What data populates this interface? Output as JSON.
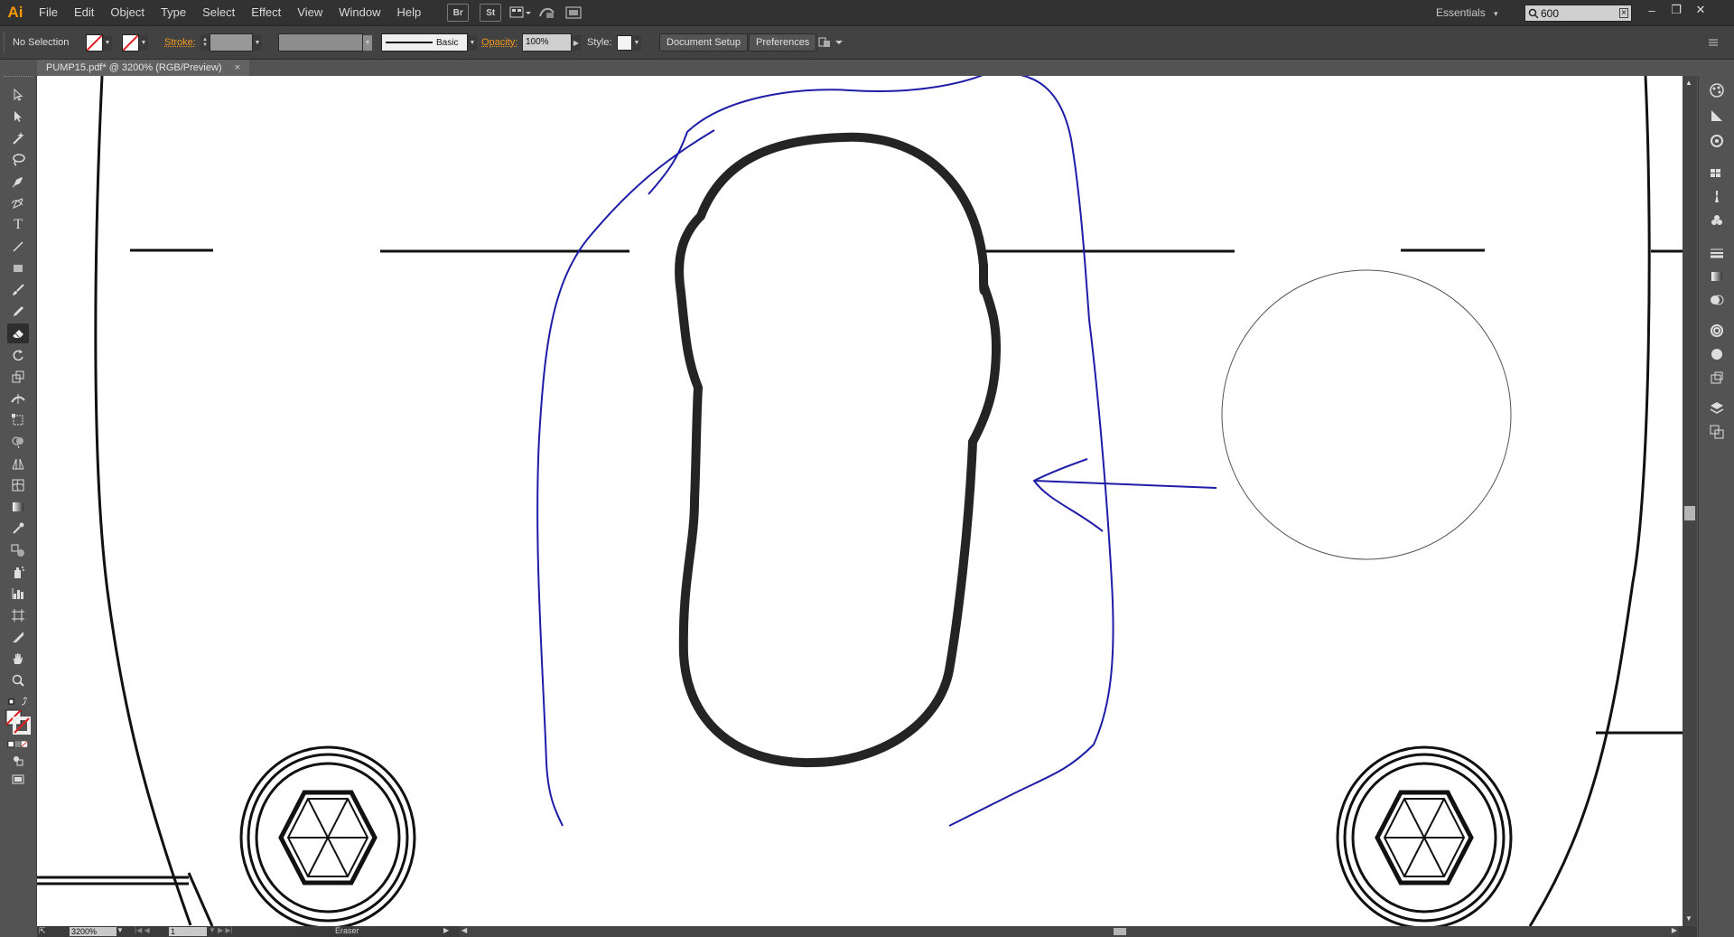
{
  "app": {
    "logo": "Ai",
    "brand_color": "#ff9a00"
  },
  "menu": [
    "File",
    "Edit",
    "Object",
    "Type",
    "Select",
    "Effect",
    "View",
    "Window",
    "Help"
  ],
  "menubar_buttons": {
    "bridge": "Br",
    "stock": "St"
  },
  "workspace": {
    "label": "Essentials",
    "arrow": "▾"
  },
  "search": {
    "value": "600"
  },
  "window_controls": {
    "minimize": "–",
    "restore": "❐",
    "close": "✕"
  },
  "control_bar": {
    "selection_label": "No Selection",
    "stroke_label": "Stroke:",
    "brush_label": "Basic",
    "opacity_label": "Opacity:",
    "opacity_value": "100%",
    "style_label": "Style:",
    "document_setup_label": "Document Setup",
    "preferences_label": "Preferences"
  },
  "document_tab": {
    "title": "PUMP15.pdf* @ 3200% (RGB/Preview)",
    "close": "×"
  },
  "status_bar": {
    "zoom": "3200%",
    "artboard": "1",
    "tool": "Eraser"
  },
  "tools": [
    "selection-tool",
    "direct-selection-tool",
    "magic-wand-tool",
    "lasso-tool",
    "pen-tool",
    "curvature-tool",
    "type-tool",
    "line-segment-tool",
    "rectangle-tool",
    "paintbrush-tool",
    "pencil-tool",
    "eraser-tool",
    "rotate-tool",
    "scale-tool",
    "width-tool",
    "free-transform-tool",
    "shape-builder-tool",
    "perspective-grid-tool",
    "mesh-tool",
    "gradient-tool",
    "eyedropper-tool",
    "blend-tool",
    "symbol-sprayer-tool",
    "column-graph-tool",
    "artboard-tool",
    "slice-tool",
    "hand-tool",
    "zoom-tool"
  ],
  "active_tool": "eraser-tool",
  "dock_icons": [
    "color-panel-icon",
    "color-guide-icon",
    "libraries-icon",
    "swatches-icon",
    "brushes-icon",
    "symbols-icon",
    "stroke-icon",
    "gradient-icon",
    "transparency-icon",
    "appearance-icon",
    "graphic-styles-icon",
    "asset-export-icon",
    "layers-icon",
    "artboards-icon"
  ],
  "colors": {
    "annotation_stroke": "#1d1da8",
    "drawing_stroke": "#111111",
    "shape_stroke": "#242424"
  }
}
